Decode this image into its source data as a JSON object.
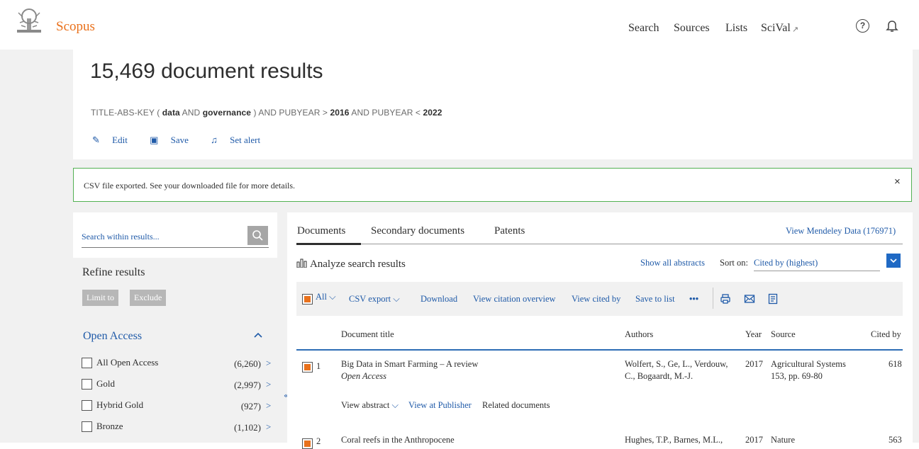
{
  "header": {
    "brand": "Scopus",
    "nav": [
      "Search",
      "Sources",
      "Lists",
      "SciVal"
    ],
    "nav_ext_mark": "↗",
    "help_icon": "?"
  },
  "results": {
    "count_title": "15,469 document results",
    "query": {
      "p1": "TITLE-ABS-KEY (",
      "t1": "data",
      "p2": "AND",
      "t2": "governance",
      "p3": ") AND PUBYEAR >",
      "y1": "2016",
      "p4": "AND PUBYEAR <",
      "y2": "2022"
    },
    "actions": {
      "edit": "Edit",
      "save": "Save",
      "alert": "Set alert"
    }
  },
  "notice": {
    "text": "CSV file exported. See your downloaded file for more details.",
    "close": "×"
  },
  "sidebar": {
    "search_placeholder": "Search within results...",
    "refine": "Refine results",
    "limit": "Limit to",
    "exclude": "Exclude",
    "facet_title": "Open Access",
    "items": [
      {
        "label": "All Open Access",
        "count": "(6,260)"
      },
      {
        "label": "Gold",
        "count": "(2,997)"
      },
      {
        "label": "Hybrid Gold",
        "count": "(927)"
      },
      {
        "label": "Bronze",
        "count": "(1,102)"
      }
    ],
    "collapse_mark": "«"
  },
  "main": {
    "tabs": [
      "Documents",
      "Secondary documents",
      "Patents"
    ],
    "mendeley": "View Mendeley Data (176971)",
    "analyze": "Analyze search results",
    "show_all": "Show all abstracts",
    "sort_label": "Sort on:",
    "sort_value": "Cited by (highest)",
    "toolbar": {
      "all": "All",
      "csv": "CSV export",
      "download": "Download",
      "overview": "View citation overview",
      "cited_by": "View cited by",
      "save_list": "Save to list",
      "more": "•••"
    },
    "columns": [
      "Document title",
      "Authors",
      "Year",
      "Source",
      "Cited by"
    ],
    "rows": [
      {
        "num": "1",
        "title": "Big Data in Smart Farming – A review",
        "access": "Open Access",
        "authors1": "Wolfert, S., Ge, L., Verdouw,",
        "authors2": "C., Bogaardt, M.-J.",
        "year": "2017",
        "source1": "Agricultural Systems",
        "source2": "153, pp. 69-80",
        "cited": "618",
        "view_abstract": "View abstract",
        "view_publisher": "View at Publisher",
        "related": "Related documents"
      },
      {
        "num": "2",
        "title": "Coral reefs in the Anthropocene",
        "authors1": "Hughes, T.P., Barnes, M.L.,",
        "year": "2017",
        "source1": "Nature",
        "cited": "563"
      }
    ]
  }
}
